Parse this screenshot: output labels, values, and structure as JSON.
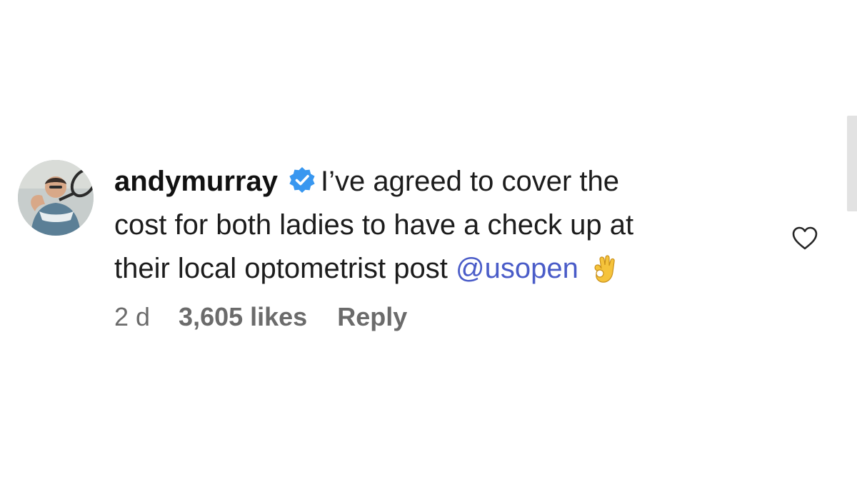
{
  "comment": {
    "username": "andymurray",
    "verified": true,
    "text_line1": "I’ve agreed to cover the",
    "text_line2": "cost for both ladies to have a check up at",
    "text_line3": "their local optometrist post",
    "mention": "@usopen",
    "emoji": "ok-hand-emoji",
    "time": "2 d",
    "likes": "3,605 likes",
    "reply_label": "Reply"
  },
  "icons": {
    "verified": "verified-badge-icon",
    "like": "heart-icon",
    "avatar": "profile-photo"
  },
  "colors": {
    "verified_badge": "#3897f0",
    "mention": "#4a5cc8",
    "meta_text": "#6b6b6b",
    "primary_text": "#1c1c1c",
    "ok_emoji": "#f5c33b"
  }
}
